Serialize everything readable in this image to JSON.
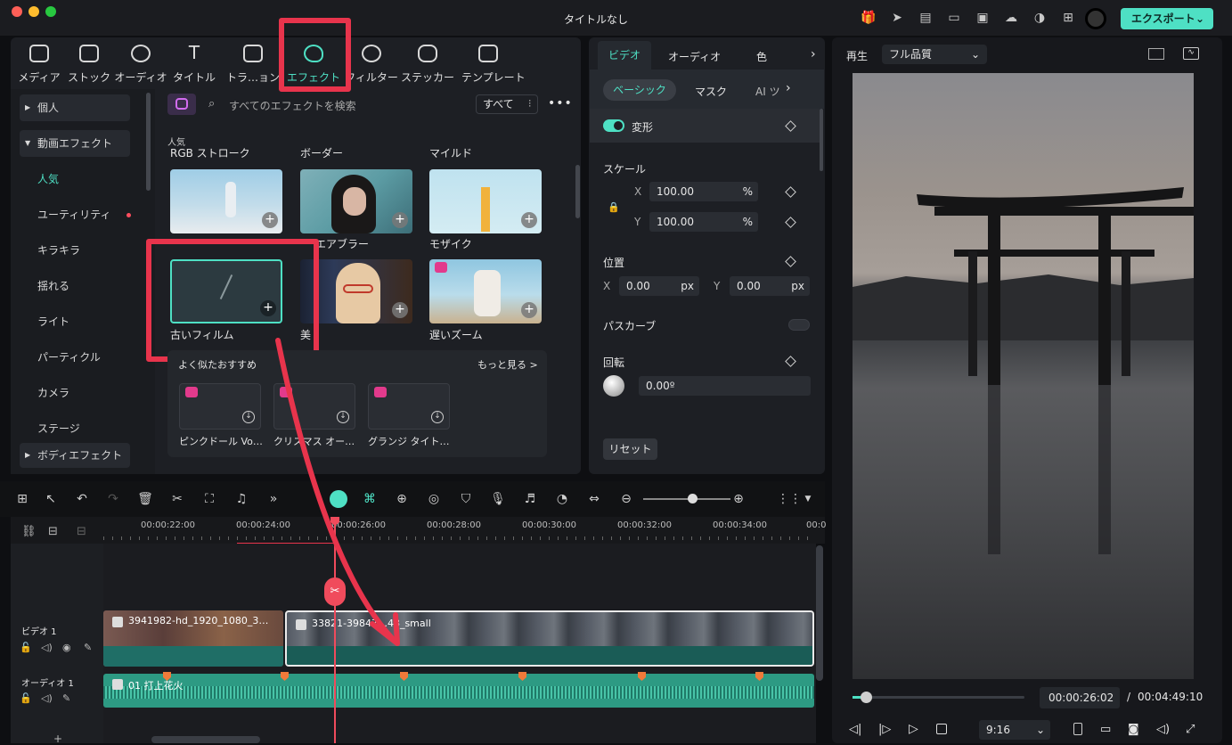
{
  "app": {
    "title": "タイトルなし",
    "export_label": "エクスポート"
  },
  "media_tabs": [
    {
      "label": "メディア",
      "icon": "media-icon"
    },
    {
      "label": "ストック",
      "icon": "stock-icon"
    },
    {
      "label": "オーディオ",
      "icon": "audio-icon"
    },
    {
      "label": "タイトル",
      "icon": "title-icon"
    },
    {
      "label": "トラ…ョン",
      "icon": "transition-icon"
    },
    {
      "label": "エフェクト",
      "icon": "effect-icon",
      "active": true
    },
    {
      "label": "フィルター",
      "icon": "filter-icon"
    },
    {
      "label": "ステッカー",
      "icon": "sticker-icon"
    },
    {
      "label": "テンプレート",
      "icon": "template-icon"
    }
  ],
  "sidebar": {
    "items": [
      {
        "label": "個人",
        "group": true
      },
      {
        "label": "動画エフェクト",
        "group": true,
        "expanded": true
      },
      {
        "label": "人気",
        "active": true
      },
      {
        "label": "ユーティリティ",
        "dot": true
      },
      {
        "label": "キラキラ"
      },
      {
        "label": "揺れる"
      },
      {
        "label": "ライト"
      },
      {
        "label": "パーティクル"
      },
      {
        "label": "カメラ"
      },
      {
        "label": "ステージ"
      },
      {
        "label": "ボディエフェクト",
        "group": true
      }
    ]
  },
  "effects": {
    "search_placeholder": "すべてのエフェクトを検索",
    "filter_label": "すべて",
    "section_label": "人気",
    "row1": [
      "RGB ストローク",
      "ボーダー",
      "マイルド"
    ],
    "row2": [
      "",
      "エアブラー",
      "モザイク"
    ],
    "row3": [
      "古いフィルム",
      "美",
      "遅いズーム"
    ],
    "recommend_title": "よく似たおすすめ",
    "more_label": "もっと見る >",
    "recommend": [
      "ピンクドール Vo…",
      "クリスマス オー…",
      "グランジ タイト…"
    ]
  },
  "properties": {
    "tabs": [
      "ビデオ",
      "オーディオ",
      "色"
    ],
    "subtabs": [
      "ベーシック",
      "マスク",
      "AI ツ"
    ],
    "transform_label": "変形",
    "scale_label": "スケール",
    "scale_x": "100.00",
    "scale_y": "100.00",
    "percent": "%",
    "position_label": "位置",
    "pos_x": "0.00",
    "pos_y": "0.00",
    "px": "px",
    "x_label": "X",
    "y_label": "Y",
    "path_curve_label": "パスカーブ",
    "rotate_label": "回転",
    "rotate_value": "0.00º",
    "reset_label": "リセット"
  },
  "preview": {
    "label": "再生",
    "quality": "フル品質",
    "current_time": "00:00:26:02",
    "separator": "/",
    "total_time": "00:04:49:10",
    "aspect": "9:16"
  },
  "timeline": {
    "ruler": [
      "00:00:22:00",
      "00:00:24:00",
      "00:00:26:00",
      "00:00:28:00",
      "00:00:30:00",
      "00:00:32:00",
      "00:00:34:00",
      "00:0"
    ],
    "video_track_label": "ビデオ 1",
    "audio_track_label": "オーディオ 1",
    "clip1_label": "3941982-hd_1920_1080_3…",
    "clip2_label": "33821-39847…48_small",
    "audio_clip_label": "01 打上花火"
  },
  "colors": {
    "accent": "#4ee0c4",
    "highlight": "#e8344c",
    "panel": "#1d1f24",
    "background": "#0e0f12"
  }
}
